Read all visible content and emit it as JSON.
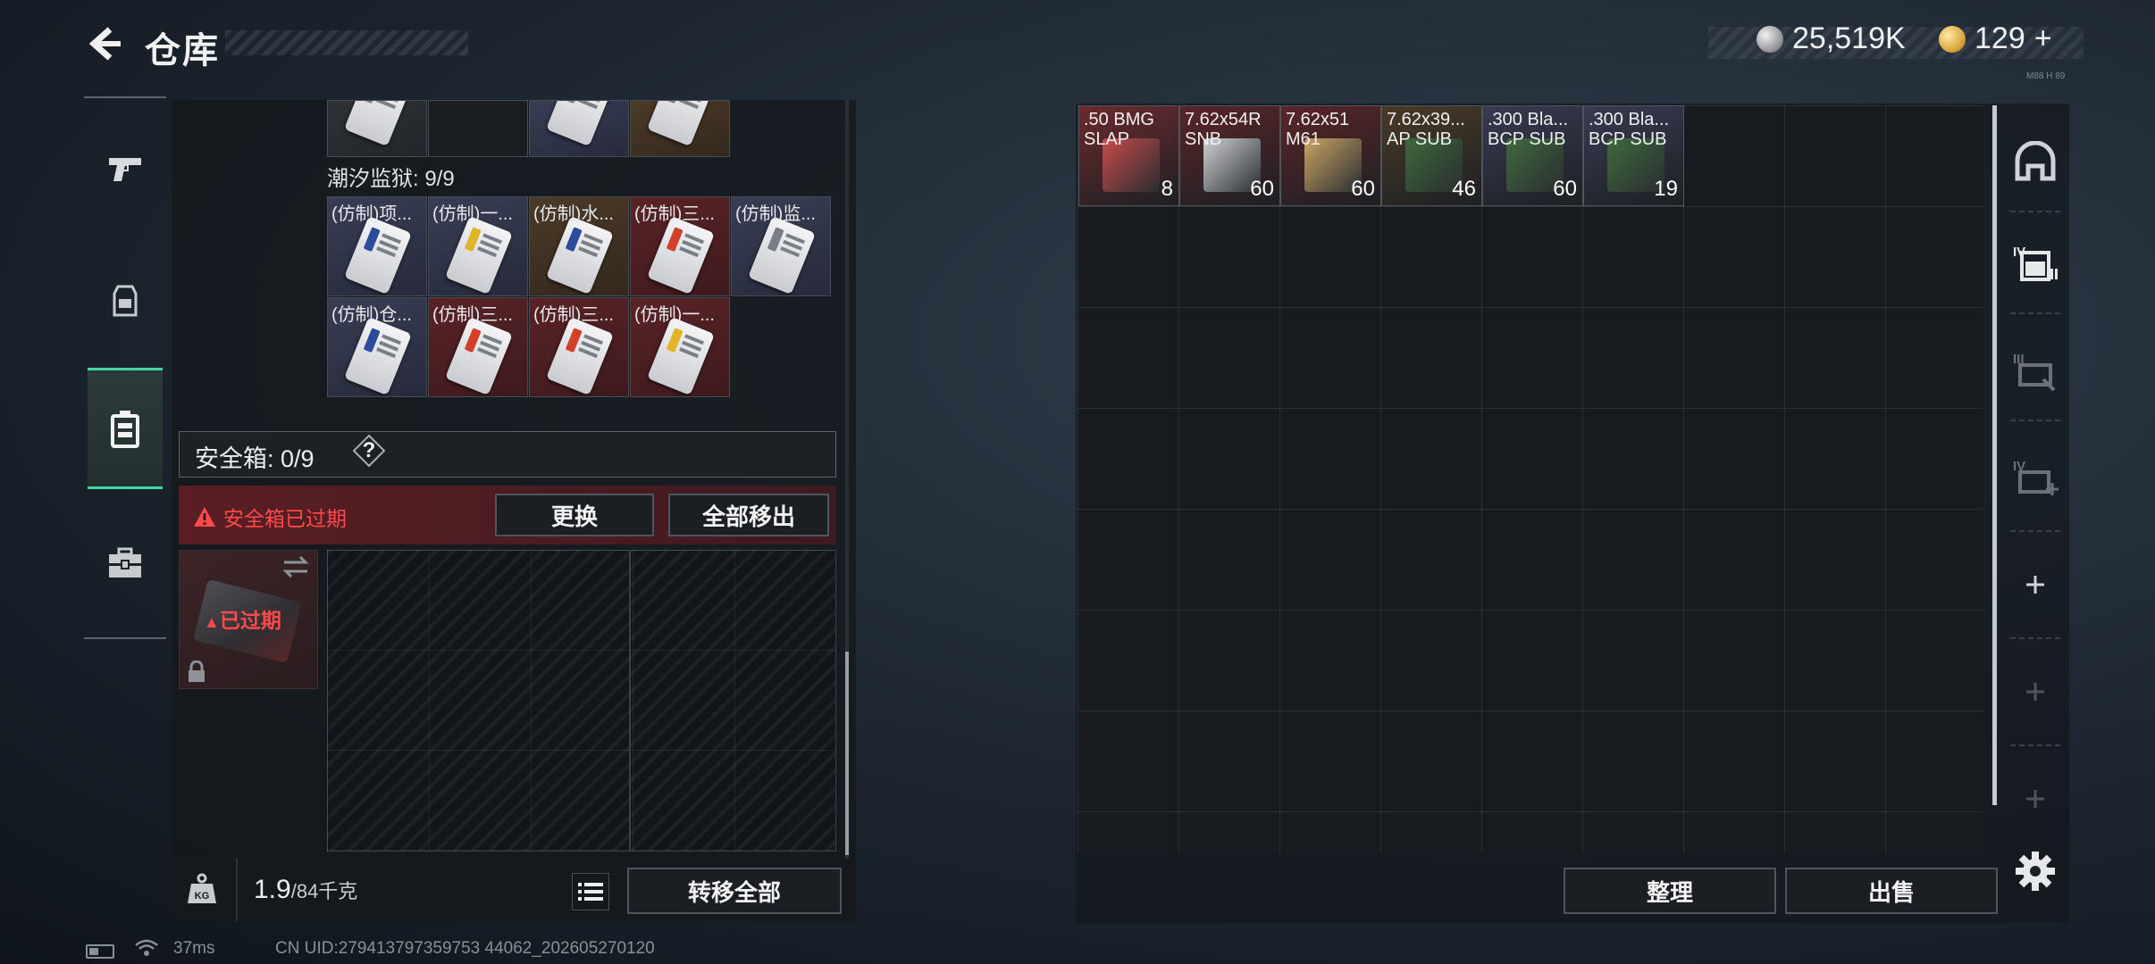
{
  "header": {
    "title": "仓库",
    "currency_a": "25,519K",
    "currency_b": "129",
    "currency_b_plus": "+",
    "tiny_code": "M88 H 89"
  },
  "sidebar": {
    "items": [
      {
        "name": "weapons-tab",
        "icon": "pistol-icon"
      },
      {
        "name": "gear-tab",
        "icon": "backpack-icon"
      },
      {
        "name": "container-tab",
        "icon": "case-icon",
        "active": true
      },
      {
        "name": "toolbox-tab",
        "icon": "toolbox-icon"
      }
    ]
  },
  "left": {
    "prison_label": "潮汐监狱: 9/9",
    "prison_items": [
      {
        "label": "(仿制)项..."
      },
      {
        "label": "(仿制)一..."
      },
      {
        "label": "(仿制)水..."
      },
      {
        "label": "(仿制)三..."
      },
      {
        "label": "(仿制)监..."
      },
      {
        "label": "(仿制)仓..."
      },
      {
        "label": "(仿制)三..."
      },
      {
        "label": "(仿制)三..."
      },
      {
        "label": "(仿制)一..."
      }
    ],
    "safe_label": "安全箱: 0/9",
    "help": "?",
    "expired_msg": "安全箱已过期",
    "replace_btn": "更换",
    "move_all_out_btn": "全部移出",
    "case_expired": "已过期",
    "weight_current": "1.9",
    "weight_max": "/84千克",
    "transfer_all_btn": "转移全部"
  },
  "status": {
    "ping": "37ms",
    "uid": "CN UID:279413797359753 44062_202605270120"
  },
  "stash": {
    "items": [
      {
        "line1": ".50 BMG",
        "line2": "SLAP",
        "qty": "8",
        "bg": "#6b2a2d",
        "box": "#c94b4b"
      },
      {
        "line1": "7.62x54R",
        "line2": "SNB",
        "qty": "60",
        "bg": "#5a2528",
        "box": "#cfd1d4"
      },
      {
        "line1": "7.62x51",
        "line2": "M61",
        "qty": "60",
        "bg": "#5a2528",
        "box": "#c9a564"
      },
      {
        "line1": "7.62x39...",
        "line2": "AP SUB",
        "qty": "46",
        "bg": "#4a3a26",
        "box": "#3e6a3a"
      },
      {
        "line1": ".300 Bla...",
        "line2": "BCP SUB",
        "qty": "60",
        "bg": "#383b52",
        "box": "#3f6a3d"
      },
      {
        "line1": ".300 Bla...",
        "line2": "BCP SUB",
        "qty": "19",
        "bg": "#383b52",
        "box": "#3f6a3d"
      }
    ],
    "sort_btn": "整理",
    "sell_btn": "出售"
  },
  "right_rail": {
    "items": [
      "helmet-icon",
      "case-iv-icon",
      "case-iii-icon",
      "case-iv-plus-icon",
      "add-icon",
      "add-icon",
      "add-icon"
    ]
  }
}
